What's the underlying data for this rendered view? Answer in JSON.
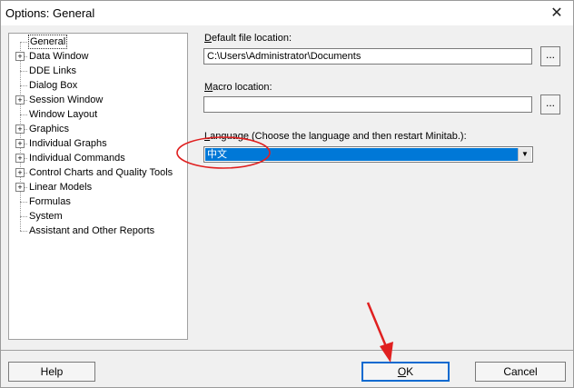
{
  "window": {
    "title": "Options: General",
    "close_symbol": "✕"
  },
  "tree": {
    "items": [
      {
        "label": "General",
        "expandable": false,
        "selected": true
      },
      {
        "label": "Data Window",
        "expandable": true
      },
      {
        "label": "DDE Links",
        "expandable": false
      },
      {
        "label": "Dialog Box",
        "expandable": false
      },
      {
        "label": "Session Window",
        "expandable": true
      },
      {
        "label": "Window Layout",
        "expandable": false
      },
      {
        "label": "Graphics",
        "expandable": true
      },
      {
        "label": "Individual Graphs",
        "expandable": true
      },
      {
        "label": "Individual Commands",
        "expandable": true
      },
      {
        "label": "Control Charts and Quality Tools",
        "expandable": true
      },
      {
        "label": "Linear Models",
        "expandable": true
      },
      {
        "label": "Formulas",
        "expandable": false
      },
      {
        "label": "System",
        "expandable": false
      },
      {
        "label": "Assistant and Other Reports",
        "expandable": false
      }
    ]
  },
  "settings": {
    "default_file_location": {
      "label_first": "D",
      "label_rest": "efault file location:",
      "value": "C:\\Users\\Administrator\\Documents",
      "browse": "..."
    },
    "macro_location": {
      "label_first": "M",
      "label_rest": "acro location:",
      "value": "",
      "browse": "..."
    },
    "language": {
      "label_first": "L",
      "label_rest": "anguage (Choose the language and then restart Minitab.):",
      "value": "中文",
      "dropdown_symbol": "▼"
    }
  },
  "buttons": {
    "help": "Help",
    "ok_first": "O",
    "ok_rest": "K",
    "cancel": "Cancel"
  },
  "annotations": {
    "circle_color": "#e02020",
    "arrow_color": "#e02020"
  }
}
